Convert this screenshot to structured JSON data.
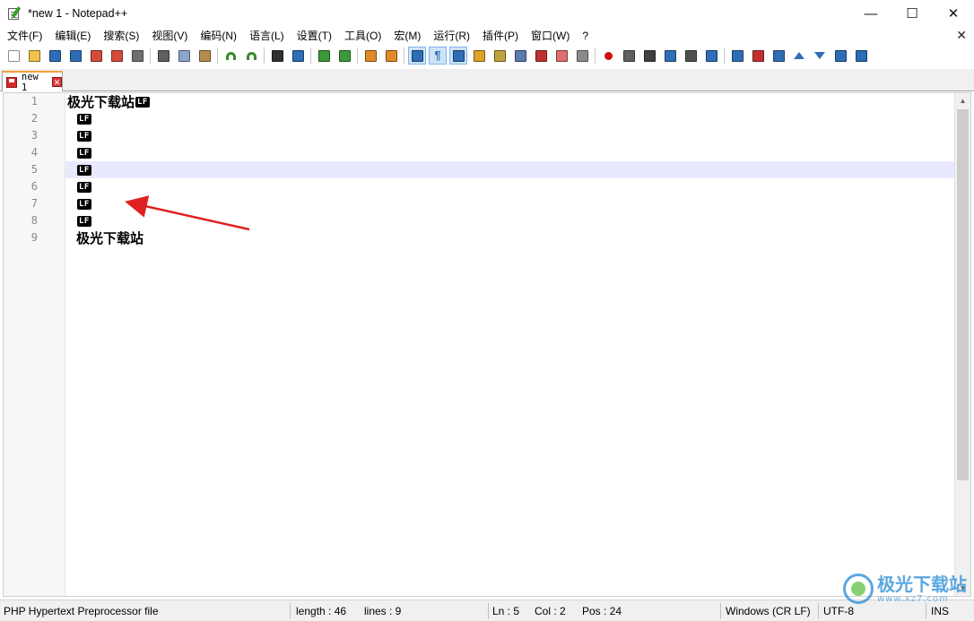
{
  "window": {
    "title": "*new 1 - Notepad++",
    "minimize_glyph": "—",
    "maximize_glyph": "☐",
    "close_glyph": "✕"
  },
  "menu": {
    "items": [
      "文件(F)",
      "编辑(E)",
      "搜索(S)",
      "视图(V)",
      "编码(N)",
      "语言(L)",
      "设置(T)",
      "工具(O)",
      "宏(M)",
      "运行(R)",
      "插件(P)",
      "窗口(W)",
      "?"
    ],
    "close_glyph": "✕"
  },
  "toolbar": {
    "icons": [
      "new-file-icon",
      "open-file-icon",
      "save-icon",
      "save-all-icon",
      "close-icon",
      "close-all-icon",
      "print-icon",
      "cut-icon",
      "copy-icon",
      "paste-icon",
      "undo-icon",
      "redo-icon",
      "find-icon",
      "replace-icon",
      "zoom-in-icon",
      "zoom-out-icon",
      "sync-vertical-icon",
      "sync-horizontal-icon",
      "word-wrap-icon",
      "show-all-characters-icon",
      "indent-guide-icon",
      "user-defined-language-icon",
      "document-map-icon",
      "document-list-icon",
      "function-list-icon",
      "folder-as-workspace-icon",
      "monitoring-icon",
      "record-macro-icon",
      "stop-recording-icon",
      "playback-macro-icon",
      "run-macro-multiple-icon",
      "save-macro-icon",
      "launch-in-browser-icon",
      "compare-icon",
      "clear-compare-icon",
      "first-diff-icon",
      "previous-diff-icon",
      "next-diff-icon",
      "last-diff-icon",
      "diff-settings-icon"
    ],
    "active": [
      "word-wrap-icon",
      "show-all-characters-icon",
      "indent-guide-icon"
    ]
  },
  "tabs": [
    {
      "label": "new 1",
      "close_glyph": "✕"
    }
  ],
  "editor": {
    "eol_marker": "LF",
    "current_line": 5,
    "lines": [
      {
        "number": "1",
        "text": "极光下载站",
        "eol": true,
        "indent": 0
      },
      {
        "number": "2",
        "text": "",
        "eol": true,
        "indent": 1
      },
      {
        "number": "3",
        "text": "",
        "eol": true,
        "indent": 1
      },
      {
        "number": "4",
        "text": "",
        "eol": true,
        "indent": 1
      },
      {
        "number": "5",
        "text": "",
        "eol": true,
        "indent": 1
      },
      {
        "number": "6",
        "text": "",
        "eol": true,
        "indent": 1
      },
      {
        "number": "7",
        "text": "",
        "eol": true,
        "indent": 1
      },
      {
        "number": "8",
        "text": "",
        "eol": true,
        "indent": 1
      },
      {
        "number": "9",
        "text": "极光下载站",
        "eol": false,
        "indent": 1
      }
    ]
  },
  "statusbar": {
    "file_type": "PHP Hypertext Preprocessor file",
    "length": "length : 46",
    "lines": "lines : 9",
    "ln": "Ln : 5",
    "col": "Col : 2",
    "pos": "Pos : 24",
    "eol_format": "Windows (CR LF)",
    "encoding": "UTF-8",
    "mode": "INS"
  },
  "watermark": {
    "main": "极光下载站",
    "sub": "www.xz7.com"
  },
  "colors": {
    "current_line": "#e8e8ff",
    "tab_accent": "#f4a23c",
    "arrow": "#e02020"
  }
}
